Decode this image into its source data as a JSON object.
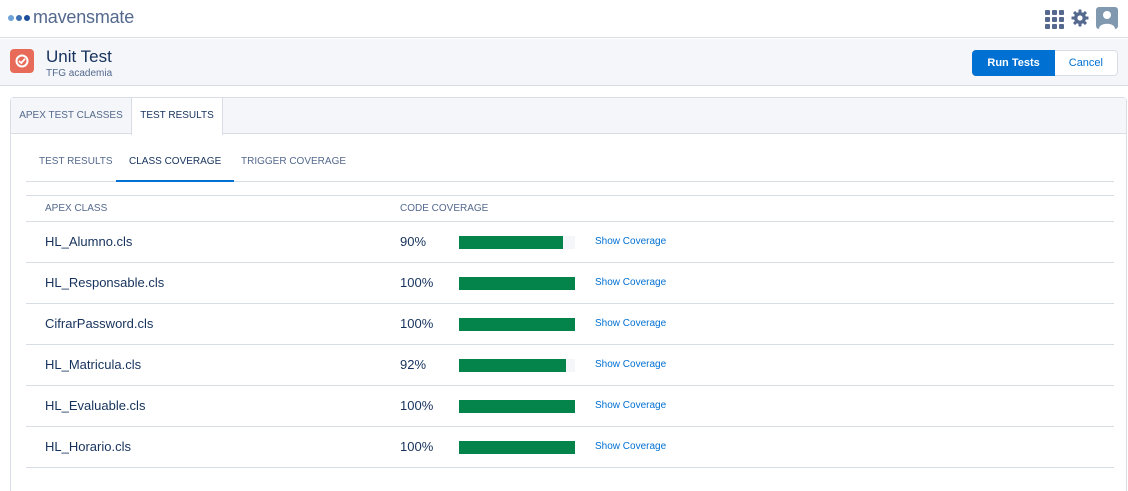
{
  "app": {
    "brand_name": "mavensmate",
    "brand_dot_colors": [
      "#6ea3d8",
      "#3d6fb3",
      "#1b4f9c"
    ]
  },
  "topbar": {
    "icons": [
      "app-launcher-icon",
      "gear-icon",
      "user-avatar-icon"
    ]
  },
  "header": {
    "title": "Unit Test",
    "subtitle": "TFG academia",
    "icon": "unit-test-icon",
    "run_button": "Run Tests",
    "cancel_button": "Cancel"
  },
  "outer_tabs": [
    "APEX TEST CLASSES",
    "TEST RESULTS"
  ],
  "inner_tabs": [
    "TEST RESULTS",
    "CLASS COVERAGE",
    "TRIGGER COVERAGE"
  ],
  "table": {
    "headers": [
      "APEX CLASS",
      "CODE COVERAGE"
    ],
    "link_label": "Show Coverage",
    "rows": [
      {
        "name": "HL_Alumno.cls",
        "coverage": "90%",
        "fraction": 0.9
      },
      {
        "name": "HL_Responsable.cls",
        "coverage": "100%",
        "fraction": 1.0
      },
      {
        "name": "CifrarPassword.cls",
        "coverage": "100%",
        "fraction": 1.0
      },
      {
        "name": "HL_Matricula.cls",
        "coverage": "92%",
        "fraction": 0.92
      },
      {
        "name": "HL_Evaluable.cls",
        "coverage": "100%",
        "fraction": 1.0
      },
      {
        "name": "HL_Horario.cls",
        "coverage": "100%",
        "fraction": 1.0
      }
    ]
  },
  "colors": {
    "accent": "#0070d2",
    "coverage_bar": "#04844b",
    "app_icon": "#e86b59"
  }
}
